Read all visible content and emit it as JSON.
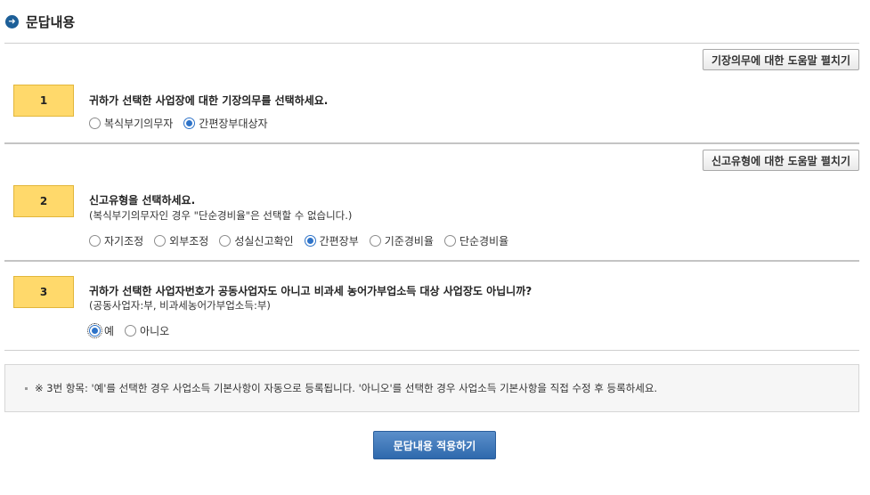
{
  "header": {
    "icon": "arrow-right-circle-icon",
    "title": "문답내용"
  },
  "q1": {
    "help_label": "기장의무에 대한 도움말 펼치기",
    "number": "1",
    "title": "귀하가 선택한 사업장에 대한 기장의무를 선택하세요.",
    "options": [
      {
        "label": "복식부기의무자",
        "checked": false
      },
      {
        "label": "간편장부대상자",
        "checked": true
      }
    ]
  },
  "q2": {
    "help_label": "신고유형에 대한 도움말 펼치기",
    "number": "2",
    "title": "신고유형을 선택하세요.",
    "note": "(복식부기의무자인 경우 \"단순경비율\"은 선택할 수 없습니다.)",
    "options": [
      {
        "label": "자기조정",
        "checked": false
      },
      {
        "label": "외부조정",
        "checked": false
      },
      {
        "label": "성실신고확인",
        "checked": false
      },
      {
        "label": "간편장부",
        "checked": true
      },
      {
        "label": "기준경비율",
        "checked": false
      },
      {
        "label": "단순경비율",
        "checked": false
      }
    ]
  },
  "q3": {
    "number": "3",
    "title": "귀하가 선택한 사업자번호가 공동사업자도 아니고 비과세 농어가부업소득 대상 사업장도 아닙니까?",
    "note": "(공동사업자:부, 비과세농어가부업소득:부)",
    "options": [
      {
        "label": "예",
        "checked": true
      },
      {
        "label": "아니오",
        "checked": false
      }
    ]
  },
  "notice": {
    "text": "※ 3번 항목: '예'를 선택한 경우 사업소득 기본사항이 자동으로 등록됩니다. '아니오'를 선택한 경우 사업소득 기본사항을 직접 수정 후 등록하세요."
  },
  "apply_button": {
    "label": "문답내용 적용하기"
  },
  "colors": {
    "accent": "#2e69ad",
    "question_box": "#ffd96b",
    "radio_checked": "#2e73c8"
  }
}
